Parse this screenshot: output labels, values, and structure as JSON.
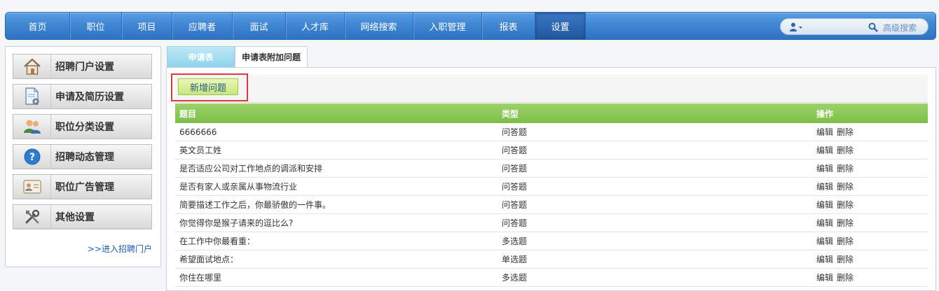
{
  "nav": {
    "items": [
      {
        "label": "首页"
      },
      {
        "label": "职位"
      },
      {
        "label": "项目"
      },
      {
        "label": "应聘者"
      },
      {
        "label": "面试"
      },
      {
        "label": "人才库"
      },
      {
        "label": "网络搜索"
      },
      {
        "label": "入职管理"
      },
      {
        "label": "报表"
      },
      {
        "label": "设置"
      }
    ],
    "active": "设置",
    "advanced_search": "高级搜索"
  },
  "sidebar": {
    "items": [
      {
        "label": "招聘门户设置",
        "icon": "home-icon"
      },
      {
        "label": "申请及简历设置",
        "icon": "document-settings-icon"
      },
      {
        "label": "职位分类设置",
        "icon": "users-group-icon"
      },
      {
        "label": "招聘动态管理",
        "icon": "help-circle-icon"
      },
      {
        "label": "职位广告管理",
        "icon": "id-card-icon"
      },
      {
        "label": "其他设置",
        "icon": "tools-icon"
      }
    ],
    "enter_portal": ">>进入招聘门户"
  },
  "tabs": [
    {
      "label": "申请表"
    },
    {
      "label": "申请表附加问题"
    }
  ],
  "active_tab": "申请表附加问题",
  "toolbar": {
    "add_label": "新增问题"
  },
  "table": {
    "headers": [
      "题目",
      "类型",
      "操作"
    ],
    "rows": [
      {
        "title": "6666666",
        "type": "问答题"
      },
      {
        "title": "英文员工姓",
        "type": "问答题"
      },
      {
        "title": "是否适应公司对工作地点的调派和安排",
        "type": "问答题"
      },
      {
        "title": "是否有家人或亲属从事物流行业",
        "type": "问答题"
      },
      {
        "title": "简要描述工作之后，你最骄傲的一件事。",
        "type": "问答题"
      },
      {
        "title": "你觉得你是猴子请来的逗比么?",
        "type": "问答题"
      },
      {
        "title": "在工作中你最看重：",
        "type": "多选题"
      },
      {
        "title": "希望面试地点：",
        "type": "单选题"
      },
      {
        "title": "你住在哪里",
        "type": "多选题"
      }
    ],
    "edit_label": "编辑",
    "delete_label": "删除"
  },
  "colors": {
    "nav_blue": "#3f86d3",
    "header_green": "#7bbf46",
    "highlight_red": "#e0383b"
  }
}
